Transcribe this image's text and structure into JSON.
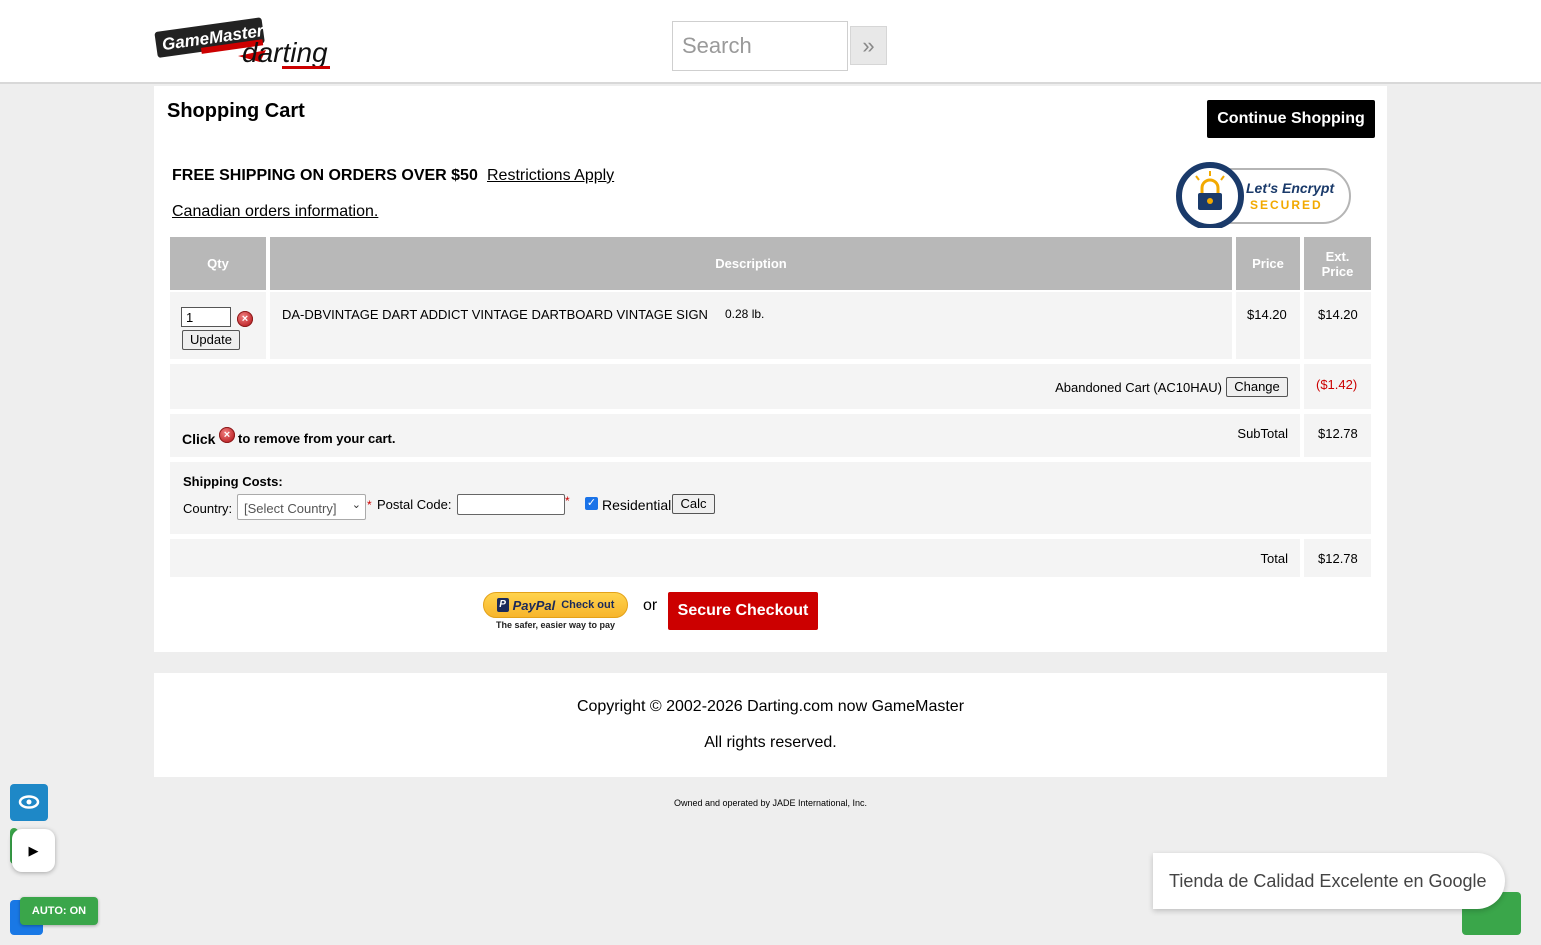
{
  "header": {
    "logo_alt": "GameMaster Darting",
    "search_placeholder": "Search",
    "search_button": "»"
  },
  "cart": {
    "title": "Shopping Cart",
    "continue_label": "Continue Shopping",
    "free_shipping": "FREE SHIPPING ON ORDERS OVER $50",
    "restrictions_link": "Restrictions Apply",
    "canadian_link": "Canadian orders information.",
    "encrypt_badge": {
      "line1": "Let's Encrypt",
      "line2": "SECURED"
    },
    "columns": {
      "qty": "Qty",
      "description": "Description",
      "price": "Price",
      "ext_price": "Ext. Price"
    },
    "items": [
      {
        "qty": "1",
        "update_label": "Update",
        "description": "DA-DBVINTAGE DART ADDICT VINTAGE DARTBOARD VINTAGE SIGN",
        "weight": "0.28 lb.",
        "price": "$14.20",
        "ext_price": "$14.20"
      }
    ],
    "discount": {
      "label": "Abandoned Cart (AC10HAU)",
      "change_label": "Change",
      "amount": "($1.42)"
    },
    "remove_hint": {
      "before": "Click",
      "after": "to remove from your cart."
    },
    "subtotal": {
      "label": "SubTotal",
      "value": "$12.78"
    },
    "shipping": {
      "heading": "Shipping Costs:",
      "country_label": "Country:",
      "country_value": "[Select Country]",
      "postal_label": "Postal Code:",
      "postal_value": "",
      "required_mark": "*",
      "residential_label": "Residential",
      "residential_checked": true,
      "calc_label": "Calc"
    },
    "total": {
      "label": "Total",
      "value": "$12.78"
    },
    "paypal": {
      "brand": "PayPal",
      "label": "Check out",
      "tagline": "The safer, easier way to pay"
    },
    "or_text": "or",
    "secure_checkout": "Secure Checkout"
  },
  "footer": {
    "copyright": "Copyright © 2002-2026 Darting.com now GameMaster",
    "rights": "All rights reserved.",
    "owned": "Owned and operated by JADE International, Inc."
  },
  "widgets": {
    "auto_label": "AUTO: ON",
    "google_badge": "Tienda de Calidad Excelente en Google"
  },
  "colors": {
    "accent_red": "#cc0000",
    "header_gray": "#b8b8b8",
    "discount_red": "#cc0000",
    "widget_green": "#3aa64a"
  }
}
